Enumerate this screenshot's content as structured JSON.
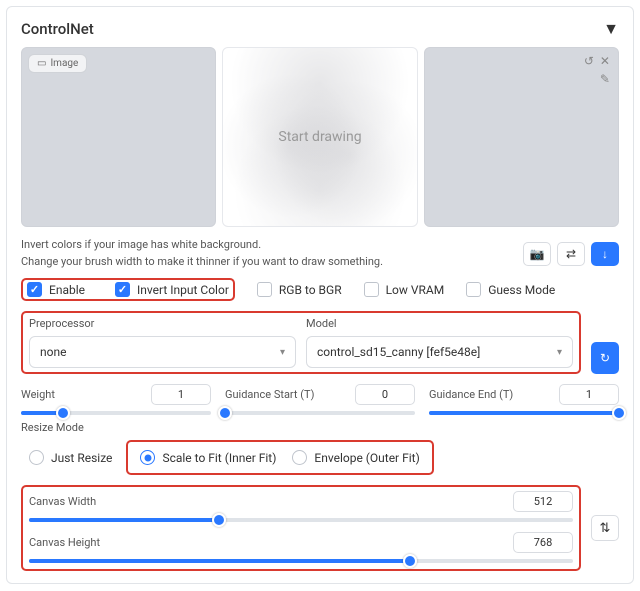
{
  "title": "ControlNet",
  "image_tab": "Image",
  "drawing_hint": "Start drawing",
  "help": {
    "line1": "Invert colors if your image has white background.",
    "line2": "Change your brush width to make it thinner if you want to draw something."
  },
  "checks": {
    "enable": "Enable",
    "invert": "Invert Input Color",
    "rgb": "RGB to BGR",
    "lowvram": "Low VRAM",
    "guess": "Guess Mode"
  },
  "preprocessor": {
    "label": "Preprocessor",
    "value": "none"
  },
  "model": {
    "label": "Model",
    "value": "control_sd15_canny [fef5e48e]"
  },
  "sliders": {
    "weight": {
      "label": "Weight",
      "value": "1",
      "pct": 22
    },
    "gstart": {
      "label": "Guidance Start (T)",
      "value": "0",
      "pct": 0
    },
    "gend": {
      "label": "Guidance End (T)",
      "value": "1",
      "pct": 100
    },
    "cwidth": {
      "label": "Canvas Width",
      "value": "512",
      "pct": 35
    },
    "cheight": {
      "label": "Canvas Height",
      "value": "768",
      "pct": 70
    }
  },
  "resize": {
    "label": "Resize Mode",
    "opts": {
      "just": "Just Resize",
      "scale": "Scale to Fit (Inner Fit)",
      "env": "Envelope (Outer Fit)"
    }
  }
}
